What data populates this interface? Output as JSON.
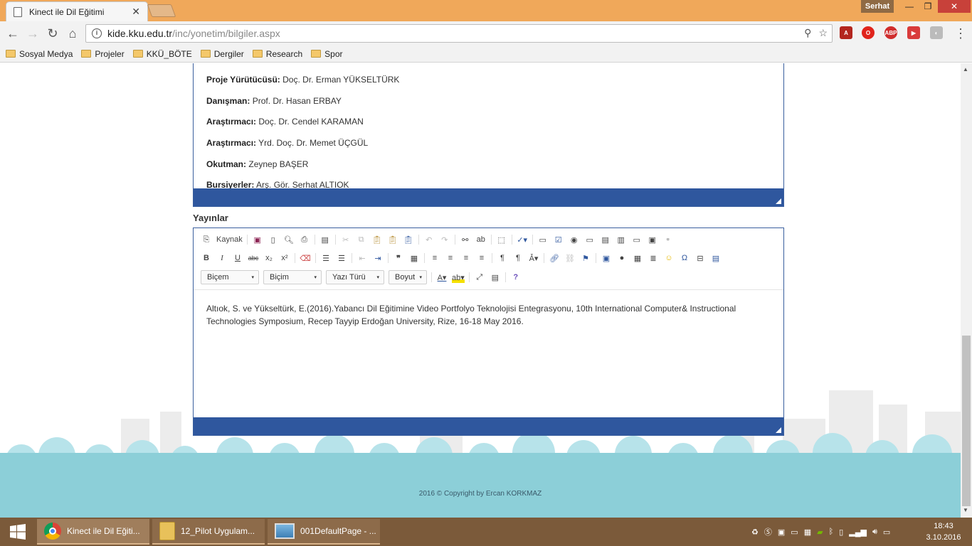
{
  "browser": {
    "tab_title": "Kinect ile Dil Eğitimi",
    "user_name": "Serhat",
    "url_host": "kide.kku.edu.tr",
    "url_path": "/inc/yonetim/bilgiler.aspx",
    "bookmarks": [
      "Sosyal Medya",
      "Projeler",
      "KKÜ_BÖTE",
      "Dergiler",
      "Research",
      "Spor"
    ]
  },
  "team": [
    {
      "role": "Proje Yürütücüsü:",
      "name": "Doç. Dr. Erman YÜKSELTÜRK"
    },
    {
      "role": "Danışman:",
      "name": "Prof. Dr. Hasan ERBAY"
    },
    {
      "role": "Araştırmacı:",
      "name": "Doç. Dr. Cendel KARAMAN"
    },
    {
      "role": "Araştırmacı:",
      "name": "Yrd. Doç. Dr. Memet ÜÇGÜL"
    },
    {
      "role": "Okutman:",
      "name": "Zeynep BAŞER"
    },
    {
      "role": "Bursiyerler:",
      "name": "Arş. Gör. Serhat ALTIOK"
    }
  ],
  "publications": {
    "label": "Yayınlar",
    "toolbar": {
      "source_label": "Kaynak",
      "combos": [
        "Biçem",
        "Biçim",
        "Yazı Türü",
        "Boyut"
      ]
    },
    "content": "Altıok, S. ve Yükseltürk, E.(2016).Yabancı Dil Eğitimine Video Portfolyo Teknolojisi Entegrasyonu, 10th International Computer& Instructional Technologies Symposium, Recep Tayyip Erdoğan University, Rize, 16-18 May 2016."
  },
  "footer": {
    "copyright": "2016 © Copyright by Ercan KORKMAZ"
  },
  "taskbar": {
    "tasks": [
      "Kinect ile Dil Eğiti...",
      "12_Pilot Uygulam...",
      "001DefaultPage - ..."
    ],
    "time": "18:43",
    "date": "3.10.2016"
  },
  "colors": {
    "editor_bar": "#2f579e",
    "titlebar": "#f0a85a",
    "taskbar": "#7b5a3a",
    "footer": "#8ccfd8"
  }
}
